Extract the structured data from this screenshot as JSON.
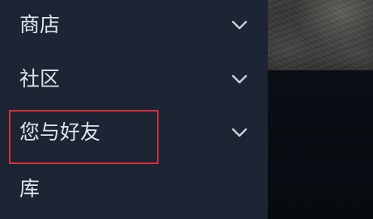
{
  "sidebar": {
    "items": [
      {
        "label": "商店",
        "icon": "chevron-down-icon"
      },
      {
        "label": "社区",
        "icon": "chevron-down-icon"
      },
      {
        "label": "您与好友",
        "icon": "chevron-down-icon"
      },
      {
        "label": "库"
      }
    ]
  },
  "highlight": {
    "color": "#d4303a",
    "target": "您与好友"
  },
  "colors": {
    "sidebar_bg": "#1d2433",
    "text": "#dfe3ea",
    "chevron": "#c9ced8",
    "content_bg": "#0a0e14"
  }
}
